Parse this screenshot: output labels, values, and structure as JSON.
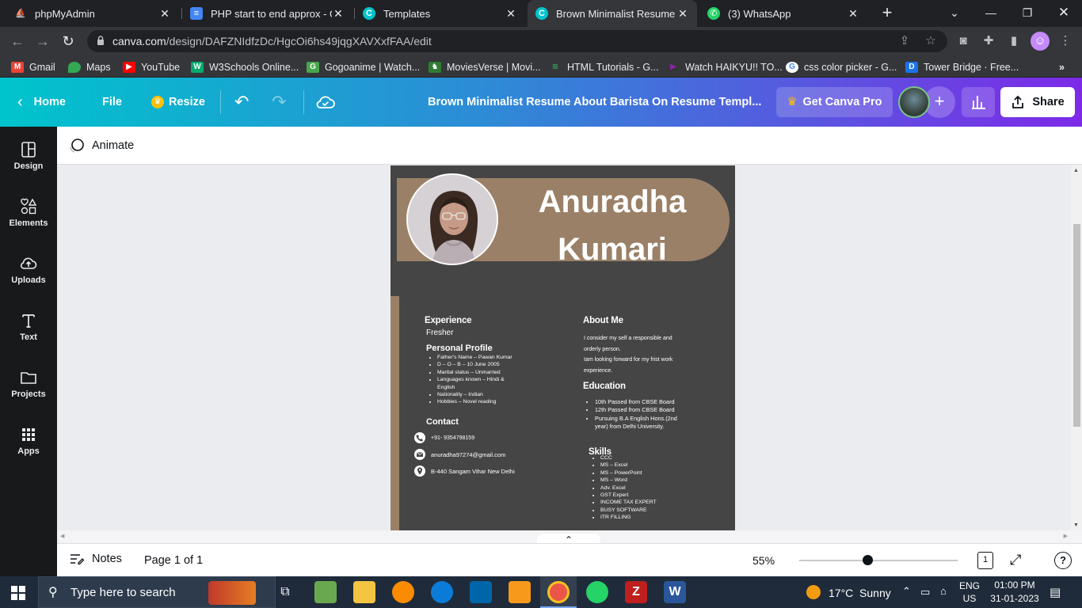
{
  "browser": {
    "tabs": [
      {
        "title": "phpMyAdmin",
        "icon": "phpmyadmin-icon"
      },
      {
        "title": "PHP start to end approx - Go",
        "icon": "docs-icon"
      },
      {
        "title": "Templates",
        "icon": "canva-icon"
      },
      {
        "title": "Brown Minimalist Resume Ab",
        "icon": "canva-icon",
        "active": true
      },
      {
        "title": "(3) WhatsApp",
        "icon": "whatsapp-icon"
      }
    ],
    "url_host": "canva.com",
    "url_path": "/design/DAFZNIdfzDc/HgcOi6hs49jqgXAVXxfFAA/edit",
    "bookmarks": [
      "Gmail",
      "Maps",
      "YouTube",
      "W3Schools Online...",
      "Gogoanime | Watch...",
      "MoviesVerse | Movi...",
      "HTML Tutorials - G...",
      "Watch HAIKYU!! TO...",
      "css color picker - G...",
      "Tower Bridge · Free..."
    ]
  },
  "canva": {
    "home": "Home",
    "file": "File",
    "resize": "Resize",
    "doc_title": "Brown Minimalist Resume About Barista On Resume Templ...",
    "get_pro": "Get Canva Pro",
    "share": "Share",
    "rail": [
      "Design",
      "Elements",
      "Uploads",
      "Text",
      "Projects",
      "Apps"
    ],
    "animate": "Animate",
    "notes": "Notes",
    "page_indicator": "Page 1 of 1",
    "zoom": "55%",
    "zoom_level": 0.43,
    "page_count": "1",
    "help": "?"
  },
  "resume": {
    "name_line1": "Anuradha",
    "name_line2": "Kumari",
    "experience_title": "Experience",
    "experience_value": "Fresher",
    "personal_title": "Personal Profile",
    "personal_items": [
      "Father's Name – Pawan Kumar",
      "D – O – B – 10 June 2005",
      "Marital status – Unmarried",
      "Languages known – Hindi &",
      "English",
      "Nationality – Indian",
      "Hobbies – Novel reading"
    ],
    "contact_title": "Contact",
    "phone": "+91- 9354798159",
    "email": "anuradha97274@gmail.com",
    "address": "B-440 Sangam Vihar New Delhi",
    "about_title": "About Me",
    "about_lines": [
      "I consider my self a responsible and",
      "orderly person.",
      "Iam looking forward for my frist work",
      "experience."
    ],
    "education_title": "Education",
    "education_items": [
      "10th Passed from CBSE Board",
      "12th Passed from CBSE Board",
      "Pursuing B.A English Hons.(2nd",
      "year) from Delhi University."
    ],
    "skills_title": "Skills",
    "skills_items": [
      "CCC",
      "MS – Excel",
      "MS – PowerPoint",
      "MS – Word",
      "Adv. Excel",
      "GST Expert",
      "INCOME TAX EXPERT",
      "BUSY SOFTWARE",
      "ITR FILLING"
    ]
  },
  "taskbar": {
    "search_placeholder": "Type here to search",
    "weather": "17°C  Sunny",
    "lang1": "ENG",
    "lang2": "US",
    "time": "01:00 PM",
    "date": "31-01-2023"
  },
  "colors": {
    "accent_tan": "#9a8067",
    "resume_bg": "#454545",
    "canva_gradient_start": "#00c4cc",
    "canva_gradient_end": "#7d2ae8"
  }
}
